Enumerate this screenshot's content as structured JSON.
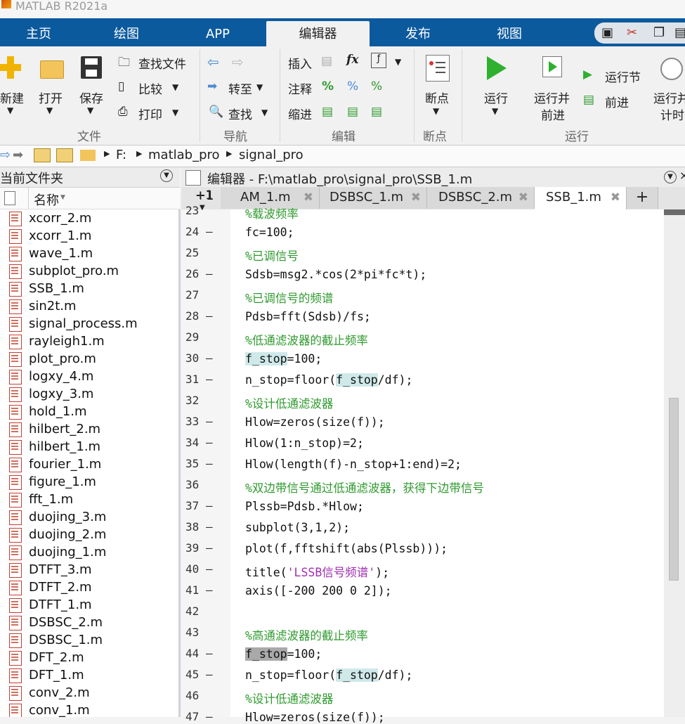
{
  "app": {
    "title": "MATLAB R2021a"
  },
  "tabs": [
    "主页",
    "绘图",
    "APP",
    "编辑器",
    "发布",
    "视图"
  ],
  "ribbon": {
    "file": {
      "new": "新建",
      "open": "打开",
      "save": "保存",
      "find_files": "查找文件",
      "compare": "比较",
      "print": "打印",
      "group": "文件"
    },
    "navigate": {
      "goto": "转至",
      "find": "查找",
      "group": "导航"
    },
    "edit": {
      "insert": "插入",
      "comment": "注释",
      "indent": "缩进",
      "fx": "fx",
      "group": "编辑"
    },
    "breakpoints": {
      "label": "断点",
      "group": "断点"
    },
    "run": {
      "run": "运行",
      "run_advance_1": "运行并",
      "run_advance_2": "前进",
      "run_section": "运行节",
      "advance": "前进",
      "run_time_1": "运行并",
      "run_time_2": "计时",
      "group": "运行"
    }
  },
  "address": {
    "drive": "F:",
    "folder1": "matlab_pro",
    "folder2": "signal_pro"
  },
  "left_panel": {
    "title": "当前文件夹",
    "col_name": "名称",
    "files": [
      "xcorr_2.m",
      "xcorr_1.m",
      "wave_1.m",
      "subplot_pro.m",
      "SSB_1.m",
      "sin2t.m",
      "signal_process.m",
      "rayleigh1.m",
      "plot_pro.m",
      "logxy_4.m",
      "logxy_3.m",
      "hold_1.m",
      "hilbert_2.m",
      "hilbert_1.m",
      "fourier_1.m",
      "figure_1.m",
      "fft_1.m",
      "duojing_3.m",
      "duojing_2.m",
      "duojing_1.m",
      "DTFT_3.m",
      "DTFT_2.m",
      "DTFT_1.m",
      "DSBSC_2.m",
      "DSBSC_1.m",
      "DFT_2.m",
      "DFT_1.m",
      "conv_2.m",
      "conv_1.m"
    ]
  },
  "editor": {
    "title": "编辑器 - F:\\matlab_pro\\signal_pro\\SSB_1.m",
    "tab_prefix": "+1",
    "tabs": [
      "AM_1.m",
      "DSBSC_1.m",
      "DSBSC_2.m",
      "SSB_1.m"
    ],
    "add_tab": "+",
    "gutter_top": "+1",
    "lines": [
      {
        "n": "23",
        "d": "",
        "segs": [
          {
            "t": "%载波频率",
            "c": "cm"
          }
        ]
      },
      {
        "n": "24",
        "d": "—",
        "segs": [
          {
            "t": "fc=100;",
            "c": ""
          }
        ]
      },
      {
        "n": "25",
        "d": "",
        "segs": [
          {
            "t": "%已调信号",
            "c": "cm"
          }
        ]
      },
      {
        "n": "26",
        "d": "—",
        "segs": [
          {
            "t": "Sdsb=msg2.*cos(2*pi*fc*t);",
            "c": ""
          }
        ]
      },
      {
        "n": "27",
        "d": "",
        "segs": [
          {
            "t": "%已调信号的频谱",
            "c": "cm"
          }
        ]
      },
      {
        "n": "28",
        "d": "—",
        "segs": [
          {
            "t": "Pdsb=fft(Sdsb)/fs;",
            "c": ""
          }
        ]
      },
      {
        "n": "29",
        "d": "",
        "segs": [
          {
            "t": "%低通滤波器的截止频率",
            "c": "cm"
          }
        ]
      },
      {
        "n": "30",
        "d": "—",
        "segs": [
          {
            "t": "f_stop",
            "c": "hl"
          },
          {
            "t": "=100;",
            "c": ""
          }
        ]
      },
      {
        "n": "31",
        "d": "—",
        "segs": [
          {
            "t": "n_stop=floor(",
            "c": ""
          },
          {
            "t": "f_stop",
            "c": "hl"
          },
          {
            "t": "/df);",
            "c": ""
          }
        ]
      },
      {
        "n": "32",
        "d": "",
        "segs": [
          {
            "t": "%设计低通滤波器",
            "c": "cm"
          }
        ]
      },
      {
        "n": "33",
        "d": "—",
        "segs": [
          {
            "t": "Hlow=zeros(size(f));",
            "c": ""
          }
        ]
      },
      {
        "n": "34",
        "d": "—",
        "segs": [
          {
            "t": "Hlow(1:n_stop)=2;",
            "c": ""
          }
        ]
      },
      {
        "n": "35",
        "d": "—",
        "segs": [
          {
            "t": "Hlow(length(f)-n_stop+1:end)=2;",
            "c": ""
          }
        ]
      },
      {
        "n": "36",
        "d": "",
        "segs": [
          {
            "t": "%双边带信号通过低通滤波器，获得下边带信号",
            "c": "cm"
          }
        ]
      },
      {
        "n": "37",
        "d": "—",
        "segs": [
          {
            "t": "Plssb=Pdsb.*Hlow;",
            "c": ""
          }
        ]
      },
      {
        "n": "38",
        "d": "—",
        "segs": [
          {
            "t": "subplot(3,1,2);",
            "c": ""
          }
        ]
      },
      {
        "n": "39",
        "d": "—",
        "segs": [
          {
            "t": "plot(f,fftshift(abs(Plssb)));",
            "c": ""
          }
        ]
      },
      {
        "n": "40",
        "d": "—",
        "segs": [
          {
            "t": "title(",
            "c": ""
          },
          {
            "t": "'LSSB信号频谱'",
            "c": "st"
          },
          {
            "t": ");",
            "c": ""
          }
        ]
      },
      {
        "n": "41",
        "d": "—",
        "segs": [
          {
            "t": "axis([-200 200 0 2]);",
            "c": ""
          }
        ]
      },
      {
        "n": "42",
        "d": "",
        "segs": [
          {
            "t": "",
            "c": ""
          }
        ]
      },
      {
        "n": "43",
        "d": "",
        "segs": [
          {
            "t": "%高通滤波器的截止频率",
            "c": "cm"
          }
        ]
      },
      {
        "n": "44",
        "d": "—",
        "segs": [
          {
            "t": "f_stop",
            "c": "hl2"
          },
          {
            "t": "=100;",
            "c": ""
          }
        ]
      },
      {
        "n": "45",
        "d": "—",
        "segs": [
          {
            "t": "n_stop=floor(",
            "c": ""
          },
          {
            "t": "f_stop",
            "c": "hl"
          },
          {
            "t": "/df);",
            "c": ""
          }
        ]
      },
      {
        "n": "46",
        "d": "",
        "segs": [
          {
            "t": "%设计低通滤波器",
            "c": "cm"
          }
        ]
      },
      {
        "n": "47",
        "d": "—",
        "segs": [
          {
            "t": "Hlow=zeros(size(f));",
            "c": ""
          }
        ]
      }
    ]
  },
  "colors": {
    "ribbon_blue": "#0c5a9e",
    "comment_green": "#2f9a2f",
    "string_purple": "#a030b0",
    "highlight": "#cfe9ea"
  }
}
